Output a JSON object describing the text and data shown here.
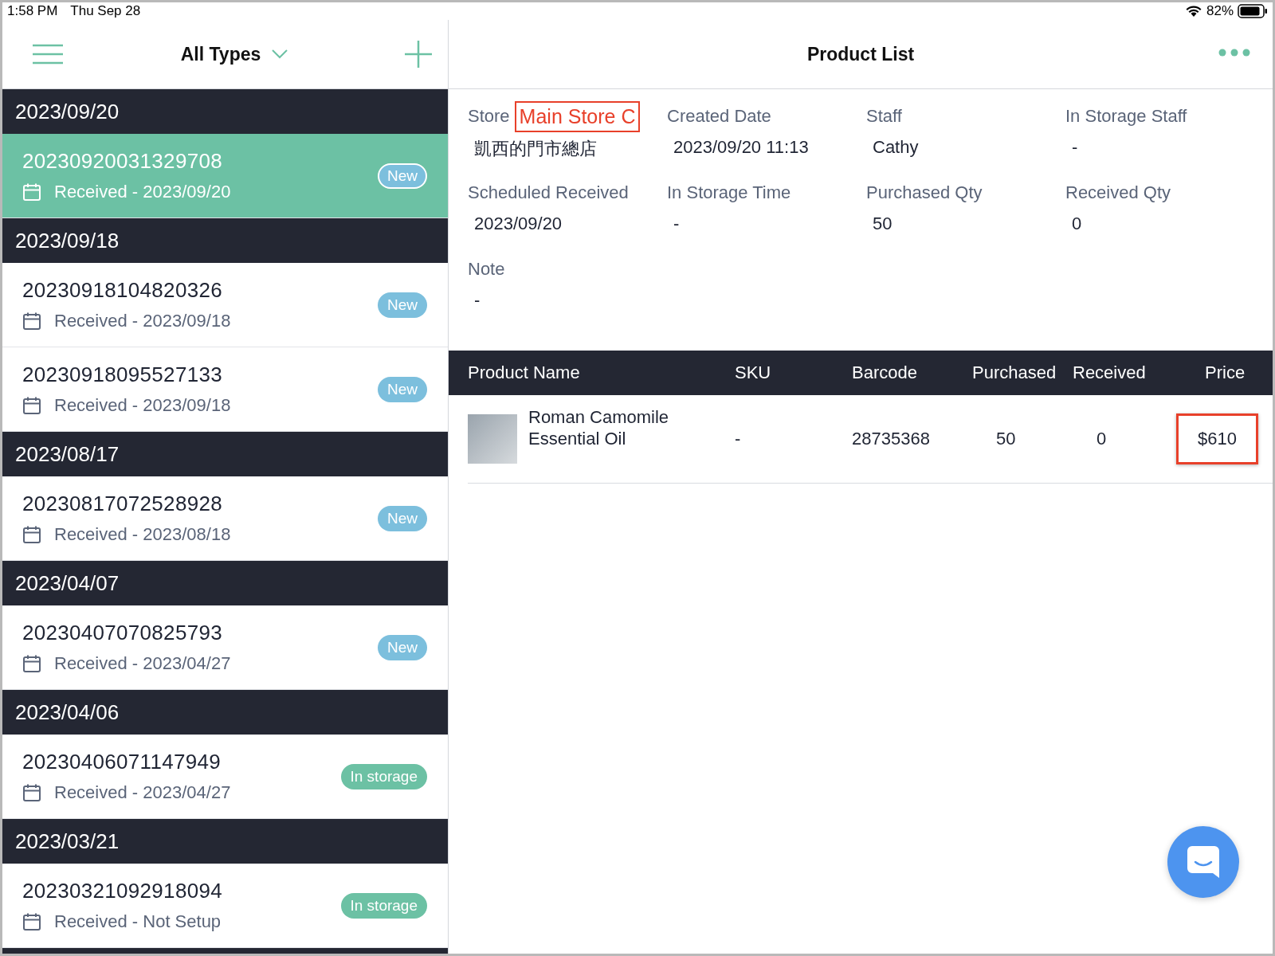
{
  "status_bar": {
    "time": "1:58 PM",
    "date": "Thu Sep 28",
    "battery": "82%"
  },
  "list_header": {
    "filter": "All Types"
  },
  "groups": [
    {
      "date": "2023/09/20",
      "orders": [
        {
          "number": "20230920031329708",
          "received": "Received - 2023/09/20",
          "status": "New",
          "kind": "new",
          "selected": true
        }
      ]
    },
    {
      "date": "2023/09/18",
      "orders": [
        {
          "number": "20230918104820326",
          "received": "Received - 2023/09/18",
          "status": "New",
          "kind": "new",
          "selected": false
        },
        {
          "number": "20230918095527133",
          "received": "Received - 2023/09/18",
          "status": "New",
          "kind": "new",
          "selected": false
        }
      ]
    },
    {
      "date": "2023/08/17",
      "orders": [
        {
          "number": "20230817072528928",
          "received": "Received - 2023/08/18",
          "status": "New",
          "kind": "new",
          "selected": false
        }
      ]
    },
    {
      "date": "2023/04/07",
      "orders": [
        {
          "number": "20230407070825793",
          "received": "Received - 2023/04/27",
          "status": "New",
          "kind": "new",
          "selected": false
        }
      ]
    },
    {
      "date": "2023/04/06",
      "orders": [
        {
          "number": "20230406071147949",
          "received": "Received - 2023/04/27",
          "status": "In storage",
          "kind": "storage",
          "selected": false
        }
      ]
    },
    {
      "date": "2023/03/21",
      "orders": [
        {
          "number": "20230321092918094",
          "received": "Received - Not Setup",
          "status": "In storage",
          "kind": "storage",
          "selected": false
        }
      ]
    }
  ],
  "detail": {
    "title": "Product List",
    "fields": [
      {
        "label": "Store",
        "annotation": "Main Store C",
        "value": "凱西的門市總店"
      },
      {
        "label": "Created Date",
        "value": "2023/09/20 11:13"
      },
      {
        "label": "Staff",
        "value": "Cathy"
      },
      {
        "label": "In Storage Staff",
        "value": "-"
      },
      {
        "label": "Scheduled Received",
        "value": "2023/09/20"
      },
      {
        "label": "In Storage Time",
        "value": "-"
      },
      {
        "label": "Purchased Qty",
        "value": "50"
      },
      {
        "label": "Received Qty",
        "value": "0"
      },
      {
        "label": "Note",
        "value": "-"
      }
    ],
    "table": {
      "columns": [
        "Product Name",
        "SKU",
        "Barcode",
        "Purchased",
        "Received",
        "Price"
      ],
      "rows": [
        {
          "name": "Roman Camomile Essential Oil",
          "sku": "-",
          "barcode": "28735368",
          "purchased": "50",
          "received": "0",
          "price": "$610",
          "price_marked": true
        }
      ]
    }
  }
}
